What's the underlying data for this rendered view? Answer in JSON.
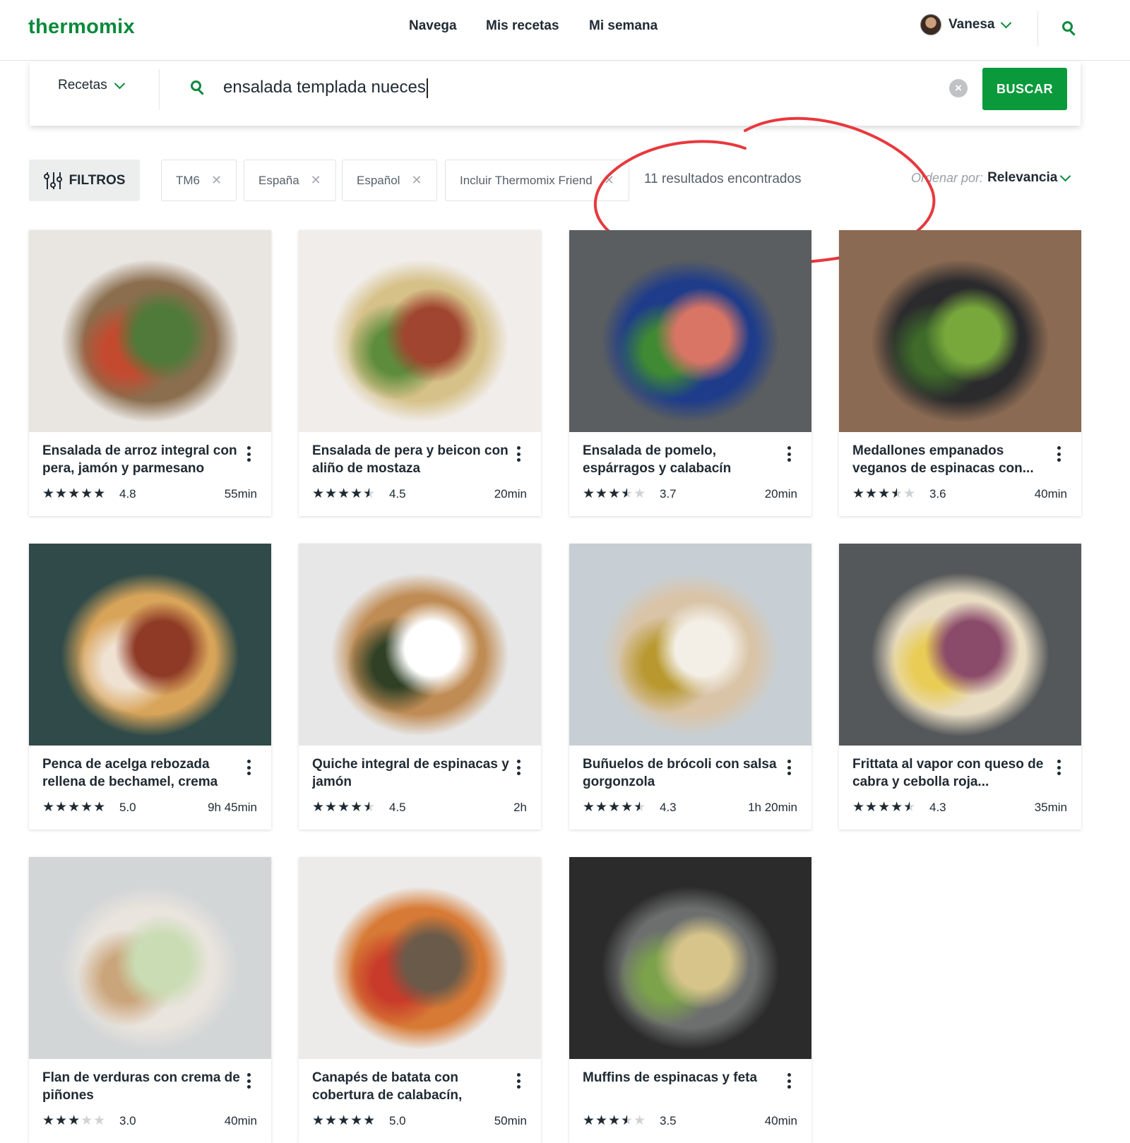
{
  "header": {
    "logo": "thermomix",
    "nav": [
      "Navega",
      "Mis recetas",
      "Mi semana"
    ],
    "user_name": "Vanesa"
  },
  "search": {
    "scope": "Recetas",
    "query": "ensalada templada nueces",
    "button": "BUSCAR"
  },
  "filters": {
    "button": "FILTROS",
    "chips": [
      "TM6",
      "España",
      "Español",
      "Incluir Thermomix Friend"
    ],
    "results_text": "11 resultados encontrados",
    "order_label": "Ordenar por:",
    "order_value": "Relevancia"
  },
  "recipes": [
    {
      "title": "Ensalada de arroz integral con pera, jamón y parmesano con...",
      "rating": "4.8",
      "stars": 5,
      "time": "55min",
      "colors": [
        "#e9e5e1",
        "#8a6e4e",
        "#c44a2f",
        "#4f7a3a"
      ]
    },
    {
      "title": "Ensalada de pera y beicon con aliño de mostaza",
      "rating": "4.5",
      "stars": 4.5,
      "time": "20min",
      "colors": [
        "#f1edeb",
        "#d6c189",
        "#5d8c3c",
        "#a0452f"
      ]
    },
    {
      "title": "Ensalada de pomelo, espárragos y calabacín",
      "rating": "3.7",
      "stars": 3.5,
      "time": "20min",
      "colors": [
        "#5b5e60",
        "#1e3c8a",
        "#3f8a33",
        "#d87565"
      ]
    },
    {
      "title": "Medallones empanados veganos de espinacas con...",
      "rating": "3.6",
      "stars": 3.5,
      "time": "40min",
      "colors": [
        "#8a6a52",
        "#2b2b2d",
        "#3e6a2a",
        "#78a83c"
      ]
    },
    {
      "title": "Penca de acelga rebozada rellena de bechamel, crema d...",
      "rating": "5.0",
      "stars": 5,
      "time": "9h 45min",
      "colors": [
        "#2f4a48",
        "#d8a45a",
        "#f0e2d3",
        "#8e3a26"
      ]
    },
    {
      "title": "Quiche integral de espinacas y jamón",
      "rating": "4.5",
      "stars": 4.5,
      "time": "2h",
      "colors": [
        "#e7e7e7",
        "#c08c55",
        "#2f4025",
        "#ffffff"
      ]
    },
    {
      "title": "Buñuelos de brócoli con salsa gorgonzola",
      "rating": "4.3",
      "stars": 4.5,
      "time": "1h 20min",
      "colors": [
        "#c8cfd4",
        "#d9c4a8",
        "#b8982f",
        "#f3efe6"
      ]
    },
    {
      "title": "Frittata al vapor con queso de cabra y cebolla roja...",
      "rating": "4.3",
      "stars": 4.5,
      "time": "35min",
      "colors": [
        "#55585a",
        "#e8dcc3",
        "#e9cc56",
        "#8a4a6a"
      ]
    },
    {
      "title": "Flan de verduras con crema de piñones",
      "rating": "3.0",
      "stars": 3,
      "time": "40min",
      "colors": [
        "#d3d6d7",
        "#e9e4dd",
        "#caa47a",
        "#c9dcb3"
      ]
    },
    {
      "title": "Canapés de batata con cobertura de calabacín, queso...",
      "rating": "5.0",
      "stars": 5,
      "time": "50min",
      "colors": [
        "#ecebe9",
        "#d77a35",
        "#c83a2a",
        "#6a5a4a"
      ]
    },
    {
      "title": "Muffins de espinacas y feta",
      "rating": "3.5",
      "stars": 3.5,
      "time": "40min",
      "colors": [
        "#2b2b2b",
        "#6d6f6e",
        "#7ca24c",
        "#d6c48a"
      ]
    }
  ]
}
